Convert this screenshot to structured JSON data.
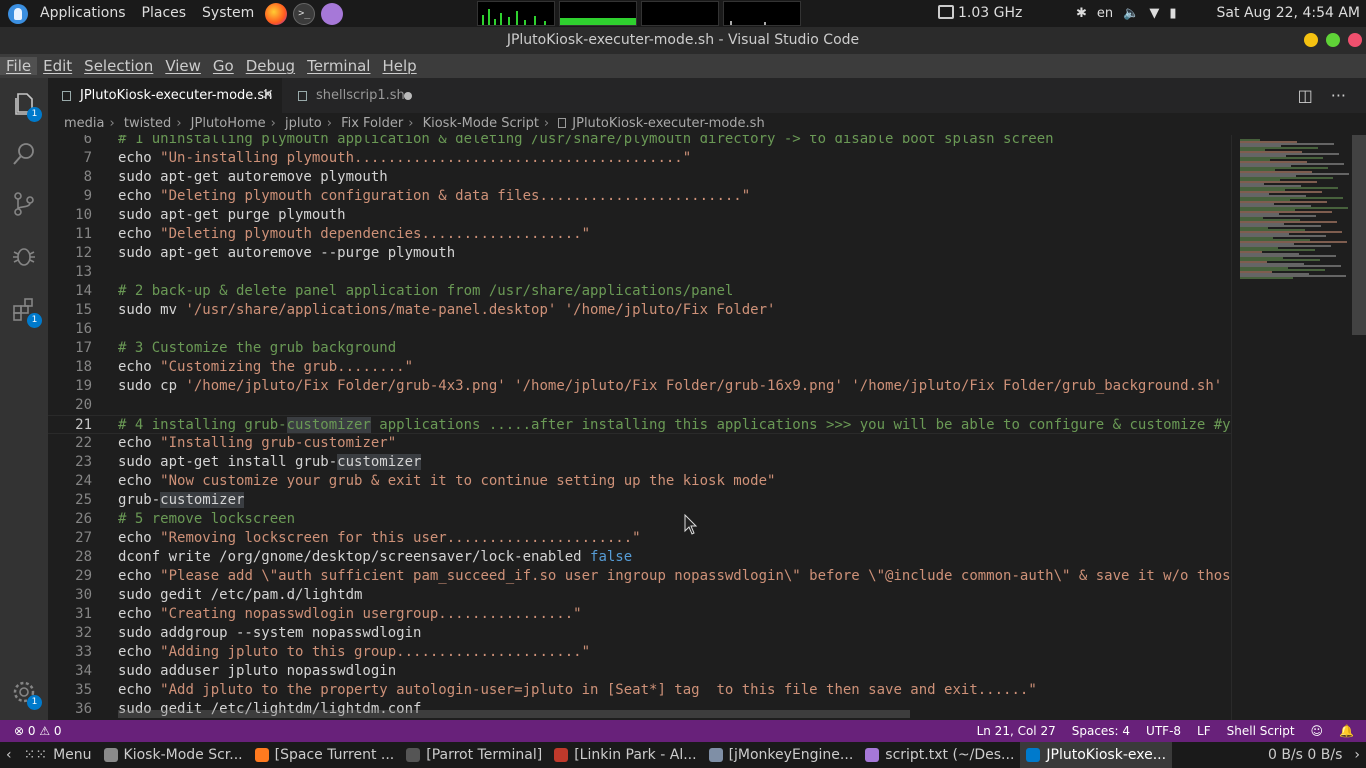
{
  "top_panel": {
    "applications": "Applications",
    "places": "Places",
    "system": "System",
    "cpu_freq": "1.03 GHz",
    "lang": "en",
    "clock": "Sat Aug 22,  4:54 AM"
  },
  "window": {
    "title": "JPlutoKiosk-executer-mode.sh - Visual Studio Code"
  },
  "menu": [
    "File",
    "Edit",
    "Selection",
    "View",
    "Go",
    "Debug",
    "Terminal",
    "Help"
  ],
  "activity_badges": {
    "explorer": "1",
    "extensions": "1",
    "settings": "1"
  },
  "tabs": [
    {
      "label": "JPlutoKiosk-executer-mode.sh",
      "active": true
    },
    {
      "label": "shellscrip1.sh",
      "active": false,
      "modified": true
    }
  ],
  "breadcrumb": [
    "media",
    "twisted",
    "JPlutoHome",
    "jpluto",
    "Fix Folder",
    "Kiosk-Mode Script",
    "JPlutoKiosk-executer-mode.sh"
  ],
  "editor": {
    "lines": [
      {
        "n": "6",
        "parts": [
          [
            "c",
            "# 1 uninstalling plymouth application & deleting /usr/share/plymouth directory -> to disable boot splash screen"
          ]
        ]
      },
      {
        "n": "7",
        "parts": [
          [
            "d",
            "echo "
          ],
          [
            "s",
            "\"Un-installing plymouth.......................................\""
          ]
        ]
      },
      {
        "n": "8",
        "parts": [
          [
            "d",
            "sudo apt-get autoremove plymouth"
          ]
        ]
      },
      {
        "n": "9",
        "parts": [
          [
            "d",
            "echo "
          ],
          [
            "s",
            "\"Deleting plymouth configuration & data files........................\""
          ]
        ]
      },
      {
        "n": "10",
        "parts": [
          [
            "d",
            "sudo apt-get purge plymouth"
          ]
        ]
      },
      {
        "n": "11",
        "parts": [
          [
            "d",
            "echo "
          ],
          [
            "s",
            "\"Deleting plymouth dependencies...................\""
          ]
        ]
      },
      {
        "n": "12",
        "parts": [
          [
            "d",
            "sudo apt-get autoremove --purge plymouth"
          ]
        ]
      },
      {
        "n": "13",
        "parts": []
      },
      {
        "n": "14",
        "parts": [
          [
            "c",
            "# 2 back-up & delete panel application from /usr/share/applications/panel"
          ]
        ]
      },
      {
        "n": "15",
        "parts": [
          [
            "d",
            "sudo mv "
          ],
          [
            "s",
            "'/usr/share/applications/mate-panel.desktop'"
          ],
          [
            "d",
            " "
          ],
          [
            "s",
            "'/home/jpluto/Fix Folder'"
          ]
        ]
      },
      {
        "n": "16",
        "parts": []
      },
      {
        "n": "17",
        "parts": [
          [
            "c",
            "# 3 Customize the grub background"
          ]
        ]
      },
      {
        "n": "18",
        "parts": [
          [
            "d",
            "echo "
          ],
          [
            "s",
            "\"Customizing the grub........\""
          ]
        ]
      },
      {
        "n": "19",
        "parts": [
          [
            "d",
            "sudo cp "
          ],
          [
            "s",
            "'/home/jpluto/Fix Folder/grub-4x3.png'"
          ],
          [
            "d",
            " "
          ],
          [
            "s",
            "'/home/jpluto/Fix Folder/grub-16x9.png'"
          ],
          [
            "d",
            " "
          ],
          [
            "s",
            "'/home/jpluto/Fix Folder/grub_background.sh'"
          ]
        ]
      },
      {
        "n": "20",
        "parts": []
      },
      {
        "n": "21",
        "current": true,
        "parts": [
          [
            "c",
            "# 4 installing grub-"
          ],
          [
            "ch",
            "customizer"
          ],
          [
            "c",
            " applications .....after installing this applications >>> you will be able to configure & customize #y"
          ]
        ]
      },
      {
        "n": "22",
        "parts": [
          [
            "d",
            "echo "
          ],
          [
            "s",
            "\"Installing grub-customizer\""
          ]
        ]
      },
      {
        "n": "23",
        "parts": [
          [
            "d",
            "sudo apt-get install grub-"
          ],
          [
            "dh",
            "customizer"
          ]
        ]
      },
      {
        "n": "24",
        "parts": [
          [
            "d",
            "echo "
          ],
          [
            "s",
            "\"Now customize your grub & exit it to continue setting up the kiosk mode\""
          ]
        ]
      },
      {
        "n": "25",
        "parts": [
          [
            "d",
            "grub-"
          ],
          [
            "dh",
            "customizer"
          ]
        ]
      },
      {
        "n": "26",
        "parts": [
          [
            "c",
            "# 5 remove lockscreen"
          ]
        ]
      },
      {
        "n": "27",
        "parts": [
          [
            "d",
            "echo "
          ],
          [
            "s",
            "\"Removing lockscreen for this user......................\""
          ]
        ]
      },
      {
        "n": "28",
        "parts": [
          [
            "d",
            "dconf write /org/gnome/desktop/screensaver/lock-enabled "
          ],
          [
            "k",
            "false"
          ]
        ]
      },
      {
        "n": "29",
        "parts": [
          [
            "d",
            "echo "
          ],
          [
            "s",
            "\"Please add \\\"auth sufficient pam_succeed_if.so user ingroup nopasswdlogin\\\" before \\\"@include common-auth\\\" & save it w/o thos"
          ]
        ]
      },
      {
        "n": "30",
        "parts": [
          [
            "d",
            "sudo gedit /etc/pam.d/lightdm"
          ]
        ]
      },
      {
        "n": "31",
        "parts": [
          [
            "d",
            "echo "
          ],
          [
            "s",
            "\"Creating nopasswdlogin usergroup................\""
          ]
        ]
      },
      {
        "n": "32",
        "parts": [
          [
            "d",
            "sudo addgroup --system nopasswdlogin"
          ]
        ]
      },
      {
        "n": "33",
        "parts": [
          [
            "d",
            "echo "
          ],
          [
            "s",
            "\"Adding jpluto to this group......................\""
          ]
        ]
      },
      {
        "n": "34",
        "parts": [
          [
            "d",
            "sudo adduser jpluto nopasswdlogin"
          ]
        ]
      },
      {
        "n": "35",
        "parts": [
          [
            "d",
            "echo "
          ],
          [
            "s",
            "\"Add jpluto to the property autologin-user=jpluto in [Seat*] tag  to this file then save and exit......\""
          ]
        ]
      },
      {
        "n": "36",
        "parts": [
          [
            "d",
            "sudo gedit /etc/lightdm/lightdm.conf"
          ]
        ]
      }
    ]
  },
  "status_bar": {
    "problems": "⊗ 0 ⚠ 0",
    "position": "Ln 21, Col 27",
    "spaces": "Spaces: 4",
    "encoding": "UTF-8",
    "eol": "LF",
    "language": "Shell Script"
  },
  "taskbar": {
    "menu": "Menu",
    "items": [
      {
        "label": "Kiosk-Mode Scr...",
        "color": "#8a8a8a"
      },
      {
        "label": "[Space Turrent ...",
        "color": "#ff7a1f"
      },
      {
        "label": "[Parrot Terminal]",
        "color": "#555555"
      },
      {
        "label": "[Linkin Park - Al...",
        "color": "#c0392b"
      },
      {
        "label": "[jMonkeyEngine...",
        "color": "#7f8fa6"
      },
      {
        "label": "script.txt (~/Des...",
        "color": "#a678d8"
      },
      {
        "label": "JPlutoKiosk-exe...",
        "color": "#007acc",
        "active": true
      }
    ],
    "net": "0 B/s  0 B/s"
  },
  "colors": {
    "accent": "#007acc",
    "status_bar": "#68217a",
    "comment": "#6a9955",
    "string": "#ce9178",
    "keyword": "#569cd6"
  }
}
